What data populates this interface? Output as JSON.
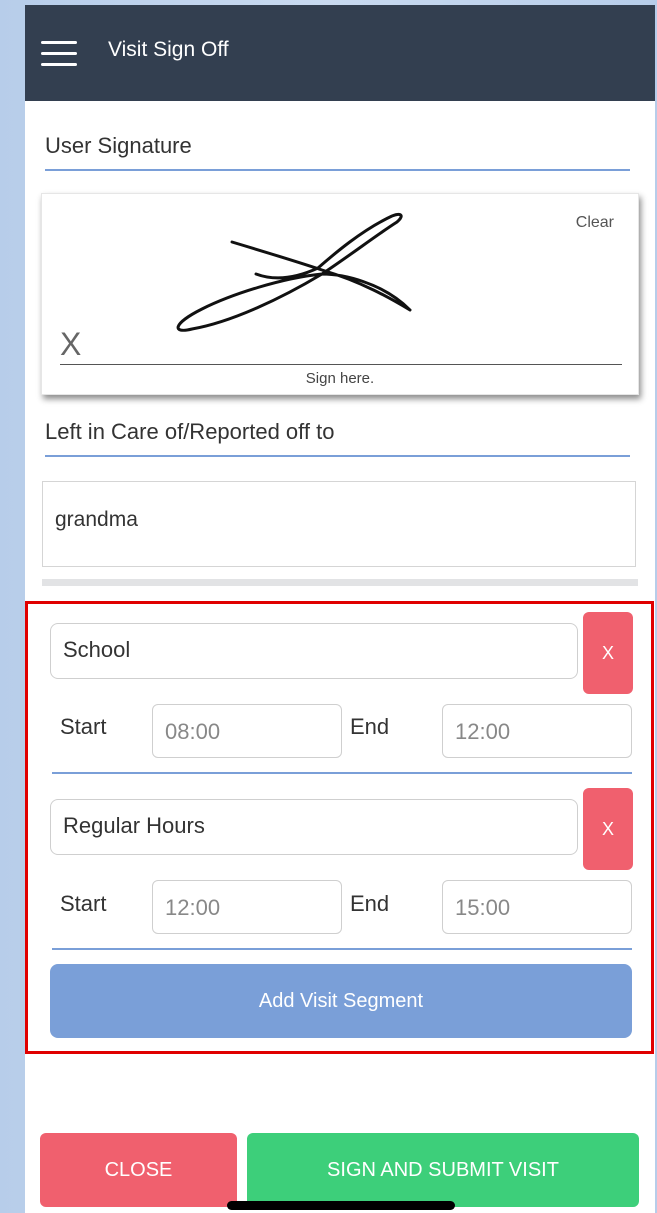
{
  "header": {
    "title": "Visit Sign Off"
  },
  "signature": {
    "section_label": "User Signature",
    "clear_label": "Clear",
    "x_mark": "X",
    "hint": "Sign here."
  },
  "care": {
    "section_label": "Left in Care of/Reported off to",
    "value": "grandma"
  },
  "segments": [
    {
      "name": "School",
      "remove_label": "X",
      "start_label": "Start",
      "start": "08:00",
      "end_label": "End",
      "end": "12:00"
    },
    {
      "name": "Regular Hours",
      "remove_label": "X",
      "start_label": "Start",
      "start": "12:00",
      "end_label": "End",
      "end": "15:00"
    }
  ],
  "add_segment_label": "Add Visit Segment",
  "footer": {
    "close_label": "CLOSE",
    "submit_label": "SIGN AND SUBMIT VISIT"
  },
  "colors": {
    "appbar": "#333f50",
    "accent": "#7a9fd8",
    "danger": "#f0606e",
    "success": "#3dcf7a",
    "highlight": "#e00000"
  }
}
